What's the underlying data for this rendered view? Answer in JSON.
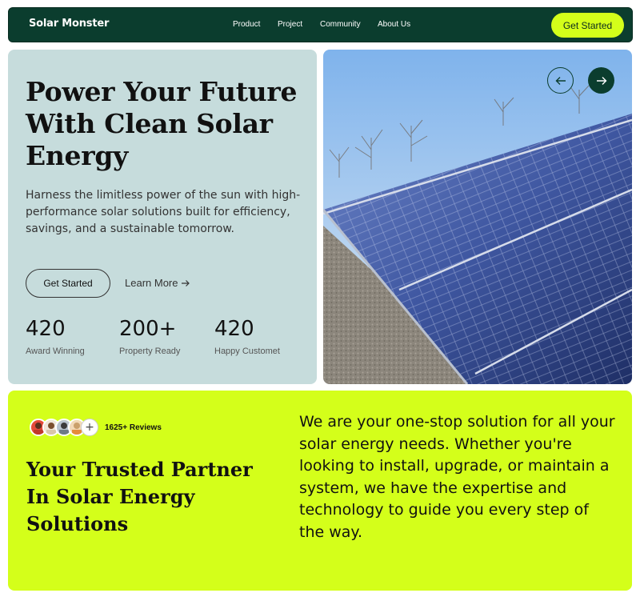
{
  "nav": {
    "brand": "Solar Monster",
    "links": [
      "Product",
      "Project",
      "Community",
      "About Us"
    ],
    "cta": "Get Started"
  },
  "hero": {
    "title": "Power Your Future With Clean Solar Energy",
    "description": "Harness the limitless power of the sun with high-performance solar solutions built for efficiency, savings, and a sustainable tomorrow.",
    "primary_button": "Get Started",
    "secondary_link": "Learn More",
    "stats": [
      {
        "value": "420",
        "label": "Award Winning"
      },
      {
        "value": "200+",
        "label": "Property Ready"
      },
      {
        "value": "420",
        "label": "Happy Customet"
      }
    ]
  },
  "carousel": {
    "prev_icon": "arrow-left-icon",
    "next_icon": "arrow-right-icon"
  },
  "partner": {
    "reviews_count": "1625+ Reviews",
    "add_icon": "+",
    "title": "Your Trusted Partner In Solar Energy Solutions",
    "text": "We are your one-stop solution for all your solar energy needs. Whether you're looking to install, upgrade, or maintain a system, we have the expertise and technology to guide you every step of the way."
  },
  "colors": {
    "dark_green": "#0b3d2e",
    "lime": "#d4ff1a",
    "hero_bg": "#c6dcdc"
  }
}
